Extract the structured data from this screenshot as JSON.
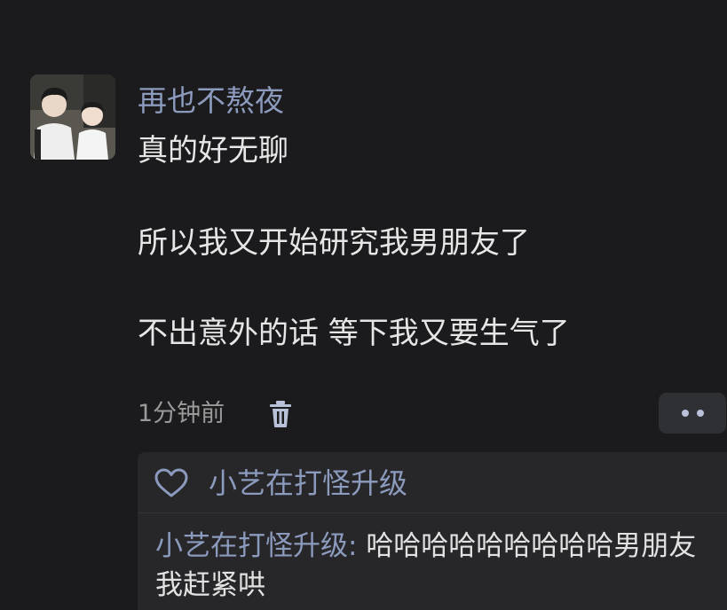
{
  "post": {
    "username": "再也不熬夜",
    "lines": [
      "真的好无聊",
      "所以我又开始研究我男朋友了",
      "不出意外的话  等下我又要生气了"
    ],
    "timestamp": "1分钟前"
  },
  "icons": {
    "delete": "trash-icon",
    "more": "more-dots-icon",
    "like": "heart-icon"
  },
  "likes": {
    "users": "小艺在打怪升级"
  },
  "comment": {
    "author": "小艺在打怪升级",
    "separator": ": ",
    "text": "哈哈哈哈哈哈哈哈哈男朋友我赶紧哄"
  },
  "colors": {
    "background": "#1b1b1d",
    "username": "#8c9bbd",
    "text": "#e6e6e6",
    "panel": "#27272a"
  }
}
